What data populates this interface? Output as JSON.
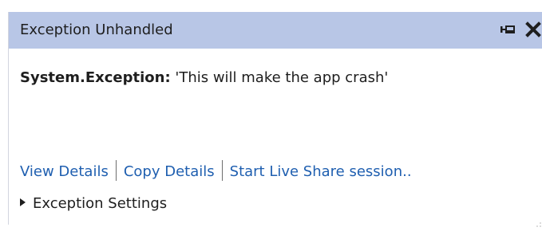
{
  "header": {
    "title": "Exception Unhandled",
    "pin_icon": "pin-icon",
    "close_icon": "close-icon"
  },
  "exception": {
    "type": "System.Exception:",
    "message": "'This will make the app crash'"
  },
  "links": {
    "view_details": "View Details",
    "copy_details": "Copy Details",
    "live_share": "Start Live Share session.."
  },
  "settings": {
    "label": "Exception Settings",
    "expand_icon": "triangle-right-icon"
  },
  "colors": {
    "header_bg": "#b8c6e6",
    "link": "#1f5fb0",
    "text": "#1e1e1e"
  }
}
